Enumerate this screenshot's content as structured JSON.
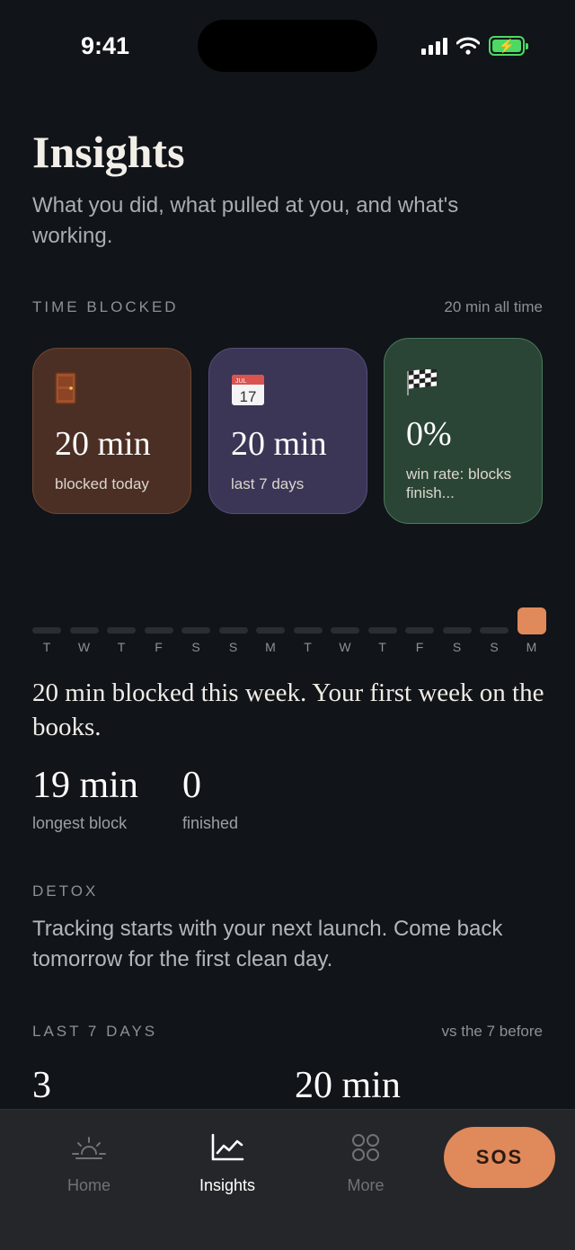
{
  "status": {
    "time": "9:41"
  },
  "header": {
    "title": "Insights",
    "subtitle": "What you did, what pulled at you, and what's working."
  },
  "time_blocked": {
    "label": "TIME BLOCKED",
    "all_time": "20 min all time",
    "cards": [
      {
        "icon": "door-icon",
        "value": "20 min",
        "label": "blocked today"
      },
      {
        "icon": "calendar-icon",
        "value": "20 min",
        "label": "last 7 days",
        "calendar_month": "JUL",
        "calendar_day": "17"
      },
      {
        "icon": "checkered-flag-icon",
        "value": "0%",
        "label": "win rate: blocks finish..."
      }
    ],
    "days": [
      "T",
      "W",
      "T",
      "F",
      "S",
      "S",
      "M",
      "T",
      "W",
      "T",
      "F",
      "S",
      "S",
      "M"
    ],
    "active_day_index": 13,
    "summary": "20 min blocked this week. Your first week on the books.",
    "stats": [
      {
        "value": "19 min",
        "label": "longest block"
      },
      {
        "value": "0",
        "label": "finished"
      }
    ]
  },
  "detox": {
    "label": "DETOX",
    "text": "Tracking starts with your next launch. Come back tomorrow for the first clean day."
  },
  "last7": {
    "label": "LAST 7 DAYS",
    "compare": "vs the 7 before",
    "values": [
      "3",
      "20 min"
    ]
  },
  "tabs": {
    "home": "Home",
    "insights": "Insights",
    "more": "More",
    "sos": "SOS"
  },
  "colors": {
    "accent": "#e0895a",
    "background": "#111418"
  }
}
